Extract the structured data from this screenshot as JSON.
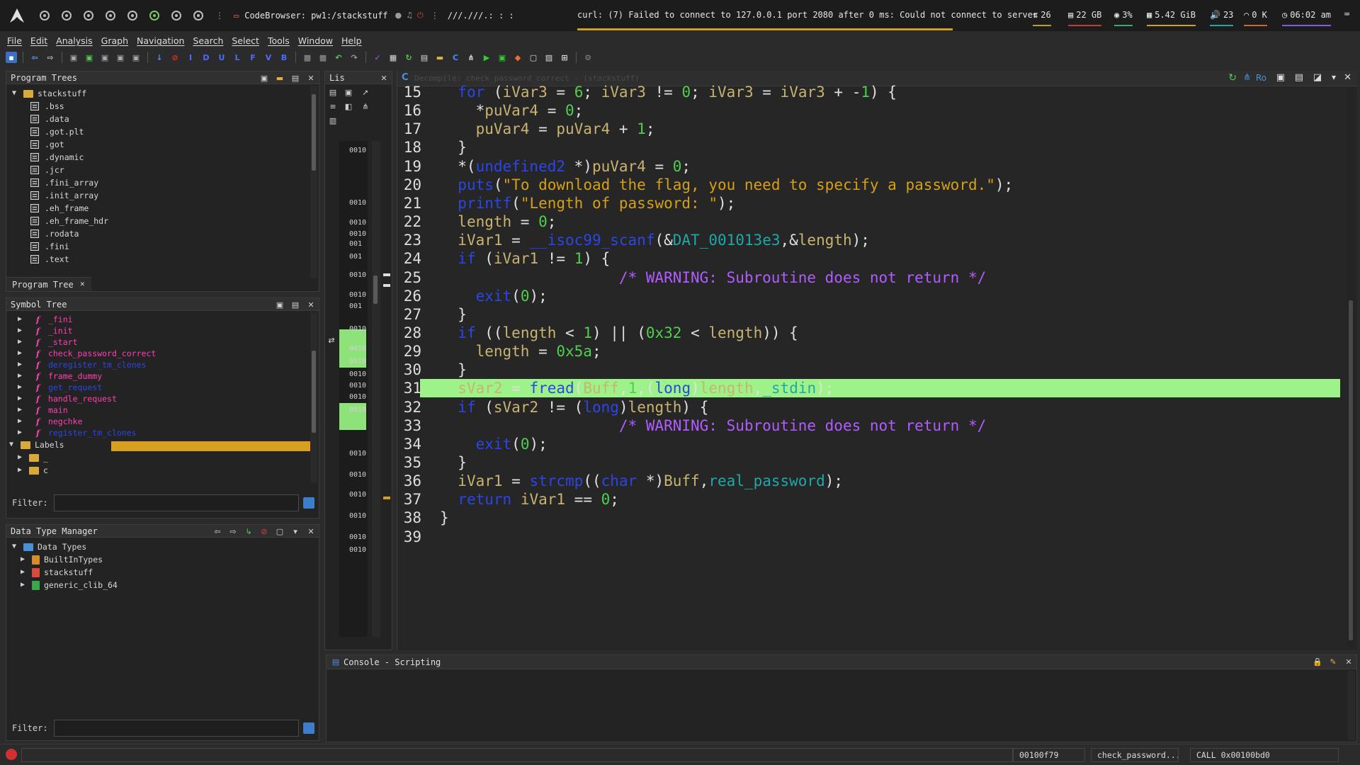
{
  "topbar": {
    "window_title": "CodeBrowser: pw1:/stackstuff",
    "path_text": "///.///.: : :",
    "curl_status": "curl: (7) Failed to connect to 127.0.0.1 port 2080 after 0 ms: Could not connect to server",
    "updates": "26",
    "disk": "22 GB",
    "cpu": "3%",
    "memory": "5.42 GiB",
    "volume": "23",
    "network": "0 K",
    "clock": "06:02 am"
  },
  "menu": [
    "File",
    "Edit",
    "Analysis",
    "Graph",
    "Navigation",
    "Search",
    "Select",
    "Tools",
    "Window",
    "Help"
  ],
  "program_trees": {
    "title": "Program Trees",
    "root": "stackstuff",
    "sections": [
      ".bss",
      ".data",
      ".got.plt",
      ".got",
      ".dynamic",
      ".jcr",
      ".fini_array",
      ".init_array",
      ".eh_frame",
      ".eh_frame_hdr",
      ".rodata",
      ".fini",
      ".text"
    ],
    "tab": "Program Tree"
  },
  "symbol_tree": {
    "title": "Symbol Tree",
    "functions": [
      {
        "name": "_fini",
        "color": "#ff3fb4"
      },
      {
        "name": "_init",
        "color": "#ff3fb4"
      },
      {
        "name": "_start",
        "color": "#ff3fb4"
      },
      {
        "name": "check_password_correct",
        "color": "#ff3fb4"
      },
      {
        "name": "deregister_tm_clones",
        "color": "#2a46e6"
      },
      {
        "name": "frame_dummy",
        "color": "#ff3fb4"
      },
      {
        "name": "get_request",
        "color": "#2a46e6"
      },
      {
        "name": "handle_request",
        "color": "#ff3fb4"
      },
      {
        "name": "main",
        "color": "#ff3fb4"
      },
      {
        "name": "negchke",
        "color": "#ff3fb4"
      },
      {
        "name": "register_tm_clones",
        "color": "#2a46e6"
      }
    ],
    "labels_folder": "Labels",
    "label_children": [
      "_",
      "c"
    ],
    "filter_label": "Filter:",
    "filter_value": ""
  },
  "data_type_manager": {
    "title": "Data Type Manager",
    "root": "Data Types",
    "items": [
      "BuiltInTypes",
      "stackstuff",
      "generic_clib_64"
    ],
    "filter_label": "Filter:",
    "filter_value": ""
  },
  "listing": {
    "tab": "Lis",
    "addresses": [
      "0010",
      "0010",
      "0010",
      "0010",
      "001",
      "001",
      "0010",
      "0010",
      "001",
      "0010",
      "0010",
      "0010",
      "0010",
      "0010",
      "0010",
      "0010",
      "0010",
      "0010",
      "0010",
      "0010",
      "0010",
      "0010"
    ]
  },
  "decompiler": {
    "header_text": "Decompile: check_password_correct - (stackstuff)",
    "lines": [
      {
        "n": "15",
        "t": "  for (iVar3 = 6; iVar3 != 0; iVar3 = iVar3 + -1) {"
      },
      {
        "n": "16",
        "t": "    *puVar4 = 0;"
      },
      {
        "n": "17",
        "t": "    puVar4 = puVar4 + 1;"
      },
      {
        "n": "18",
        "t": "  }"
      },
      {
        "n": "19",
        "t": "  *(undefined2 *)puVar4 = 0;"
      },
      {
        "n": "20",
        "t": "  puts(\"To download the flag, you need to specify a password.\");"
      },
      {
        "n": "21",
        "t": "  printf(\"Length of password: \");"
      },
      {
        "n": "22",
        "t": "  length = 0;"
      },
      {
        "n": "23",
        "t": "  iVar1 = __isoc99_scanf(&DAT_001013e3,&length);"
      },
      {
        "n": "24",
        "t": "  if (iVar1 != 1) {"
      },
      {
        "n": "25",
        "t": "                    /* WARNING: Subroutine does not return */"
      },
      {
        "n": "26",
        "t": "    exit(0);"
      },
      {
        "n": "27",
        "t": "  }"
      },
      {
        "n": "28",
        "t": "  if ((length < 1) || (0x32 < length)) {"
      },
      {
        "n": "29",
        "t": "    length = 0x5a;"
      },
      {
        "n": "30",
        "t": "  }"
      },
      {
        "n": "31",
        "t": "  sVar2 = fread(Buff,1,(long)length,_stdin);"
      },
      {
        "n": "32",
        "t": "  if (sVar2 != (long)length) {"
      },
      {
        "n": "33",
        "t": "                    /* WARNING: Subroutine does not return */"
      },
      {
        "n": "34",
        "t": "    exit(0);"
      },
      {
        "n": "35",
        "t": "  }"
      },
      {
        "n": "36",
        "t": "  iVar1 = strcmp((char *)Buff,real_password);"
      },
      {
        "n": "37",
        "t": "  return iVar1 == 0;"
      },
      {
        "n": "38",
        "t": "}"
      },
      {
        "n": "39",
        "t": ""
      }
    ],
    "highlight_line": 16
  },
  "console": {
    "title": "Console - Scripting"
  },
  "status": {
    "address": "00100f79",
    "function": "check_password...",
    "instruction": "CALL 0x00100bd0"
  }
}
